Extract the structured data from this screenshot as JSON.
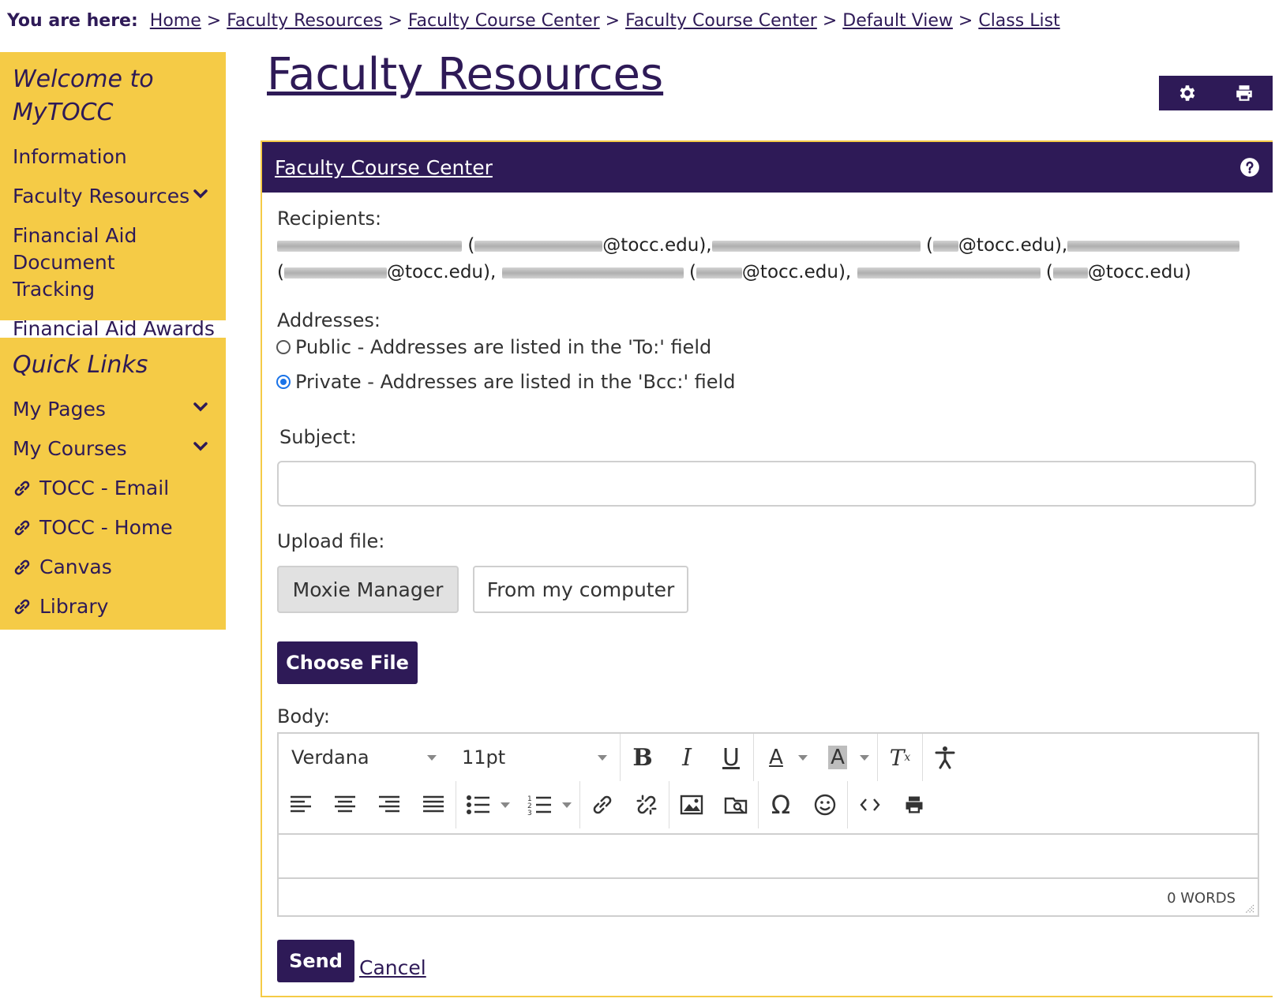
{
  "breadcrumb": {
    "label": "You are here:",
    "items": [
      "Home",
      "Faculty Resources",
      "Faculty Course Center",
      "Faculty Course Center",
      "Default View",
      "Class List"
    ],
    "separator": ">"
  },
  "sidebar": {
    "welcome_title": "Welcome to MyTOCC",
    "welcome_items": [
      "Information",
      "Faculty Resources",
      "Financial Aid Document Tracking",
      "Financial Aid Awards"
    ],
    "quick_title": "Quick Links",
    "quick_menus": [
      "My Pages",
      "My Courses"
    ],
    "quick_links": [
      "TOCC - Email",
      "TOCC - Home",
      "Canvas",
      "Library"
    ]
  },
  "page": {
    "title": "Faculty Resources"
  },
  "panel": {
    "title": "Faculty Course Center",
    "recipients_label": "Recipients:",
    "recipient_domain": "@tocc.edu",
    "addresses_label": "Addresses:",
    "address_options": [
      {
        "label": "Public - Addresses are listed in the 'To:' field",
        "checked": false
      },
      {
        "label": "Private - Addresses are listed in the 'Bcc:' field",
        "checked": true
      }
    ],
    "subject_label": "Subject:",
    "subject_value": "",
    "upload_label": "Upload file:",
    "upload_tabs": [
      "Moxie Manager",
      "From my computer"
    ],
    "choose_file_label": "Choose File",
    "body_label": "Body:",
    "font_family": "Verdana",
    "font_size": "11pt",
    "word_count": "0 WORDS",
    "send_label": "Send",
    "cancel_label": "Cancel"
  },
  "colors": {
    "brand_purple": "#2e1a57",
    "brand_gold": "#f5cb46",
    "radio_blue": "#1a73e8"
  }
}
